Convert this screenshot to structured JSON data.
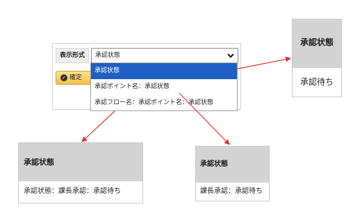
{
  "form": {
    "label": "表示形式",
    "selected_value": "承認状態",
    "confirm_label": "確定"
  },
  "dropdown": {
    "options": [
      "承認状態",
      "承認ポイント名：承認状態",
      "承認フロー名：承認ポイント名：承認状態"
    ]
  },
  "cards": {
    "state": {
      "header": "承認状態",
      "value": "承認待ち"
    },
    "flow": {
      "header": "承認状態",
      "value": "承認状態：課長承認：承認待ち"
    },
    "point": {
      "header": "承認状態",
      "value": "課長承認：承認待ち"
    }
  },
  "colors": {
    "arrow": "#e0342a",
    "selected_option": "#1e5fc4",
    "card_header": "#d3d3d3",
    "confirm_button": "#f3c24a"
  },
  "icons": {
    "select_chevron": "chevron-down-icon",
    "confirm": "check-circle-icon"
  }
}
